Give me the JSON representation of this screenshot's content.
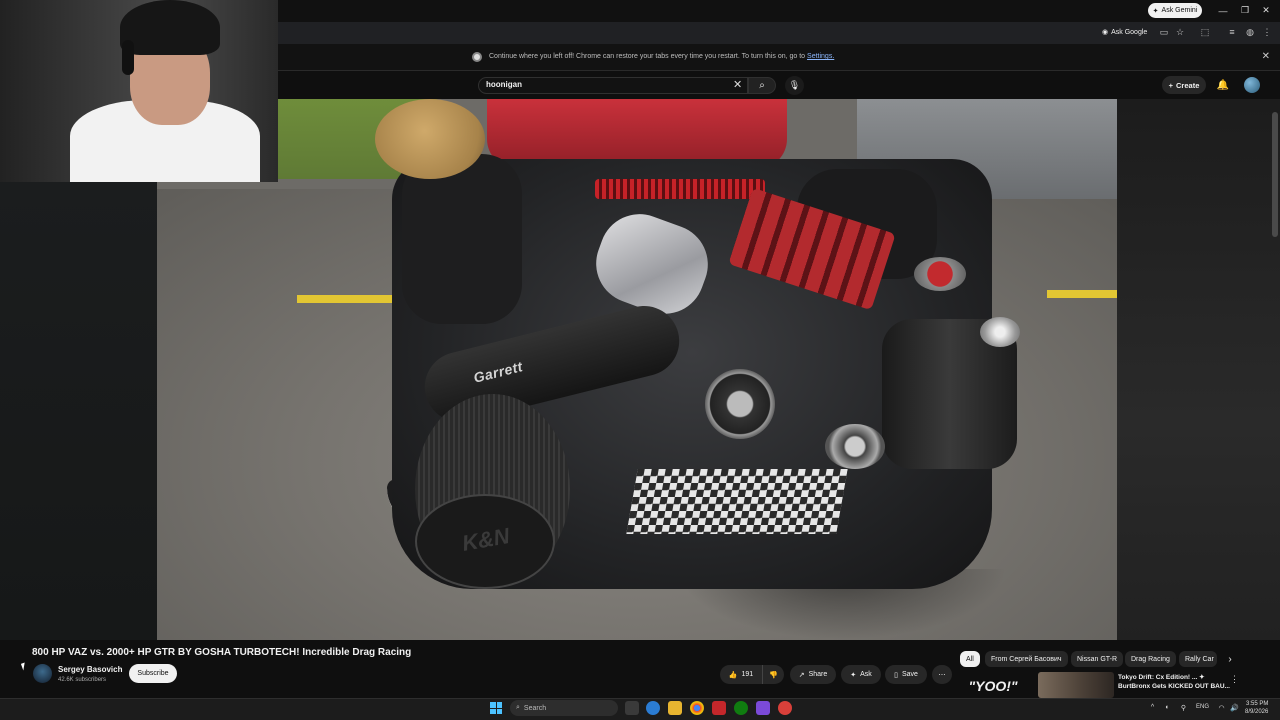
{
  "browser": {
    "ask_gemini_label": "Ask Gemini",
    "ask_google_label": "Ask Google",
    "infobar": {
      "text": "Continue where you left off! Chrome can restore your tabs every time you restart. To turn this on, go to",
      "link": "Settings."
    }
  },
  "youtube": {
    "search": {
      "query": "hoonigan"
    },
    "create_label": "Create",
    "video": {
      "title": "800 HP VAZ vs. 2000+ HP GTR BY GOSHA TURBOTECH! Incredible Drag Racing",
      "overlay_text_1": "Garrett",
      "overlay_text_2": "K&N"
    },
    "channel": {
      "name": "Sergey Basovich",
      "subscribers": "42.6K subscribers",
      "subscribe_label": "Subscribe"
    },
    "actions": {
      "like_count": "191",
      "share_label": "Share",
      "ask_label": "Ask",
      "save_label": "Save"
    },
    "chips": [
      "All",
      "From Сергей Басович",
      "Nissan GT-R",
      "Drag Racing",
      "Rally Car"
    ],
    "recommended": {
      "thumb_text": "\"YOO!\"",
      "title": "Tokyo Drift: Cx Edition! ... ✦ BurtBronx Gets KICKED OUT BAU..."
    }
  },
  "taskbar": {
    "search_placeholder": "Search",
    "language": "ENG",
    "time": "3:55 PM",
    "date": "8/9/2026"
  },
  "colors": {
    "accent_blue": "#8ab4f8",
    "windows_blue": "#4cc2ff",
    "yt_background": "#0f0f0f"
  }
}
